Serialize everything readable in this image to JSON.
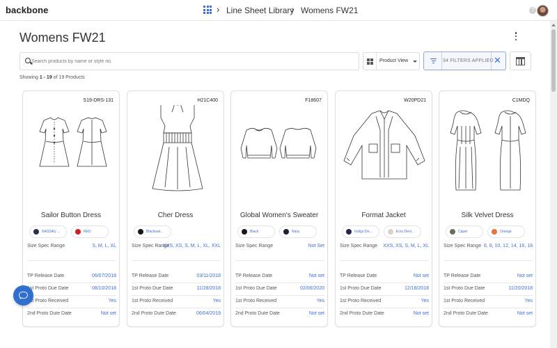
{
  "app": {
    "logo": "backbone"
  },
  "breadcrumb": {
    "items": [
      "Line Sheet Library",
      "Womens FW21"
    ],
    "separator": "›"
  },
  "header": {
    "help": "?"
  },
  "page": {
    "title": "Womens FW21"
  },
  "toolbar": {
    "search_placeholder": "Search products by name or style no.",
    "view_label": "Product View",
    "filters_label": "34 FILTERS APPLIED",
    "clear_filters": "✕"
  },
  "showing": {
    "prefix": "Showing",
    "range": "1 - 19",
    "suffix": "of 19 Products"
  },
  "accent_color": "#3f6fd1",
  "products": [
    {
      "style_no": "S19-DRS-131",
      "name": "Sailor Button Dress",
      "colors": [
        {
          "name": "NASSAU ...",
          "hex": "#2b2f4a"
        },
        {
          "name": "RED",
          "hex": "#d21f1f"
        }
      ],
      "size_spec_label": "Size Spec Range",
      "size_spec": "S, M, L, XL",
      "tp_release_label": "TP Release Date",
      "tp_release": "06/07/2018",
      "proto1_due_label": "1st Proto Due Date",
      "proto1_due": "08/10/2018",
      "proto1_received_label": "1st Proto Received",
      "proto1_received": "Yes",
      "proto2_due_label": "2nd Proto Dute Date",
      "proto2_due": "Not set"
    },
    {
      "style_no": "H21C400",
      "name": "Cher Dress",
      "colors": [
        {
          "name": "Blackwat...",
          "hex": "#15181c"
        }
      ],
      "size_spec_label": "Size Spec Range",
      "size_spec": "XXS, XS, S, M, L, XL, XXL",
      "tp_release_label": "TP Release Date",
      "tp_release": "03/11/2018",
      "proto1_due_label": "1st Proto Due Date",
      "proto1_due": "11/28/2018",
      "proto1_received_label": "1st Proto Received",
      "proto1_received": "Yes",
      "proto2_due_label": "2nd Proto Dute Date",
      "proto2_due": "06/04/2019"
    },
    {
      "style_no": "F18607",
      "name": "Global Women's Sweater",
      "colors": [
        {
          "name": "Black",
          "hex": "#1a1a1a"
        },
        {
          "name": "Navy",
          "hex": "#1b2236"
        }
      ],
      "size_spec_label": "Size Spec Range",
      "size_spec": "Not Set",
      "tp_release_label": "TP Release Date",
      "tp_release": "Not set",
      "proto1_due_label": "1st Proto Due Date",
      "proto1_due": "02/06/2020",
      "proto1_received_label": "1st Proto Received",
      "proto1_received": "Yes",
      "proto2_due_label": "2nd Proto Dute Date",
      "proto2_due": "Not set"
    },
    {
      "style_no": "W20PD21",
      "name": "Format Jacket",
      "colors": [
        {
          "name": "Indigo De...",
          "hex": "#1e2a44"
        },
        {
          "name": "Ecru Deni...",
          "hex": "#d9d3c6"
        }
      ],
      "size_spec_label": "Size Spec Range",
      "size_spec": "XXS, XS, S, M, L, XL",
      "tp_release_label": "TP Release Date",
      "tp_release": "Not set",
      "proto1_due_label": "1st Proto Due Date",
      "proto1_due": "12/18/2018",
      "proto1_received_label": "1st Proto Received",
      "proto1_received": "Yes",
      "proto2_due_label": "2nd Proto Dute Date",
      "proto2_due": "Not set"
    },
    {
      "style_no": "C1MDQ",
      "name": "Silk Velvet Dress",
      "colors": [
        {
          "name": "Caper",
          "hex": "#6b6e58"
        },
        {
          "name": "Orange",
          "hex": "#e9743c"
        }
      ],
      "size_spec_label": "Size Spec Range",
      "size_spec": "6, 8, 10, 12, 14, 16, 18",
      "tp_release_label": "TP Release Date",
      "tp_release": "Not set",
      "proto1_due_label": "1st Proto Due Date",
      "proto1_due": "11/20/2018",
      "proto1_received_label": "1st Proto Received",
      "proto1_received": "Yes",
      "proto2_due_label": "2nd Proto Dute Date",
      "proto2_due": "Not set"
    }
  ]
}
